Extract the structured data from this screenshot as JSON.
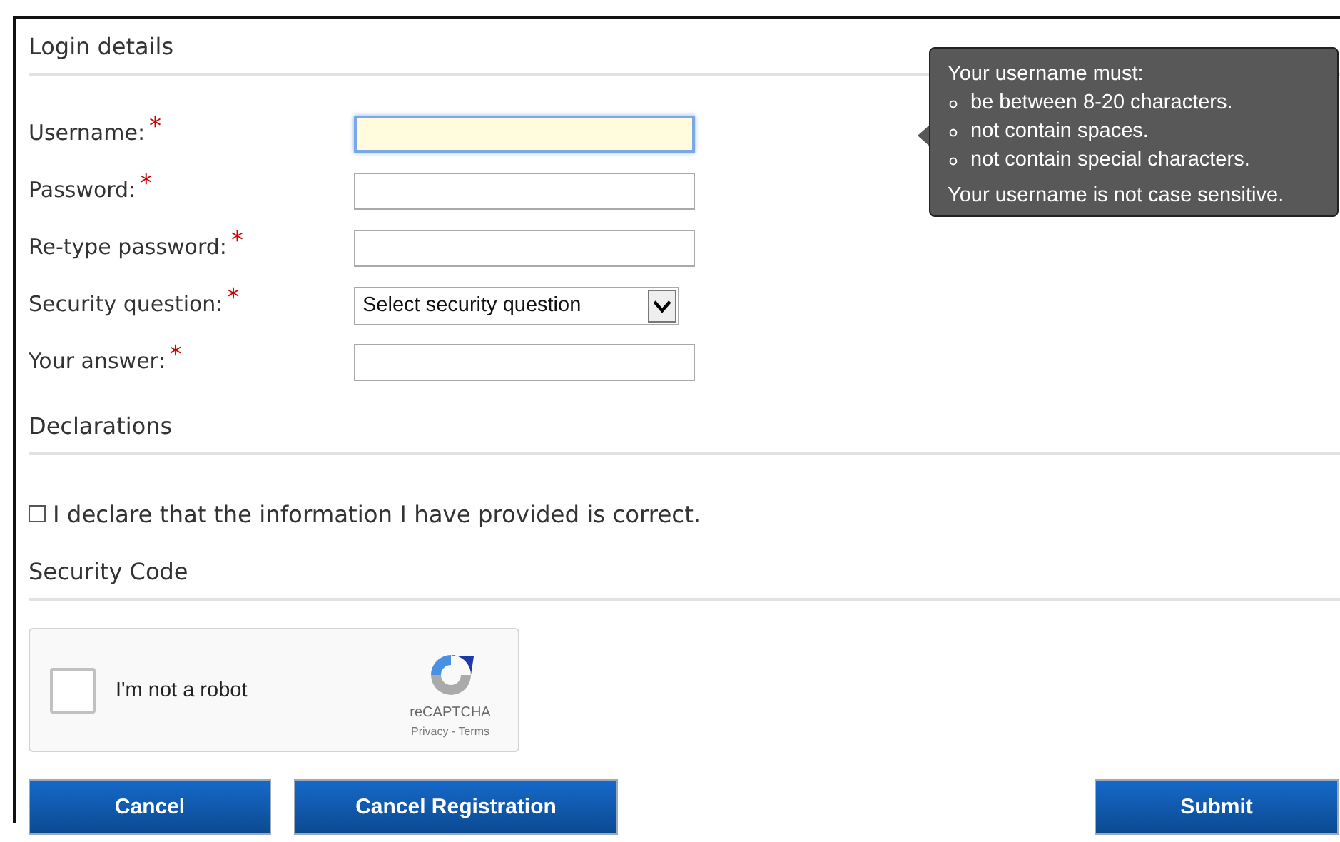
{
  "sections": [
    {
      "heading": "Login details"
    },
    {
      "heading": "Declarations"
    },
    {
      "heading": "Security Code"
    }
  ],
  "fields": [
    {
      "kind": "text",
      "label": "Username:",
      "required_mark": "*",
      "focused": true
    },
    {
      "kind": "text",
      "label": "Password:",
      "required_mark": "*",
      "focused": false
    },
    {
      "kind": "text",
      "label": "Re-type password:",
      "required_mark": "*",
      "focused": false
    },
    {
      "kind": "select",
      "label": "Security question:",
      "required_mark": "*",
      "value": "Select security question",
      "focused": false
    },
    {
      "kind": "text",
      "label": "Your answer:",
      "required_mark": "*",
      "focused": false
    }
  ],
  "tooltip": {
    "title": "Your username must:",
    "rules": [
      "be between 8-20 characters.",
      "not contain spaces.",
      "not contain special characters."
    ],
    "note": "Your username is not case sensitive."
  },
  "declaration": {
    "label": "I declare that the information I have provided is correct.",
    "checked": false
  },
  "captcha": {
    "label": "I'm not a robot",
    "checked": false,
    "brand": "reCAPTCHA",
    "links": "Privacy - Terms"
  },
  "buttons": [
    {
      "label": "Cancel"
    },
    {
      "label": "Cancel Registration"
    },
    {
      "label": "Submit"
    }
  ]
}
